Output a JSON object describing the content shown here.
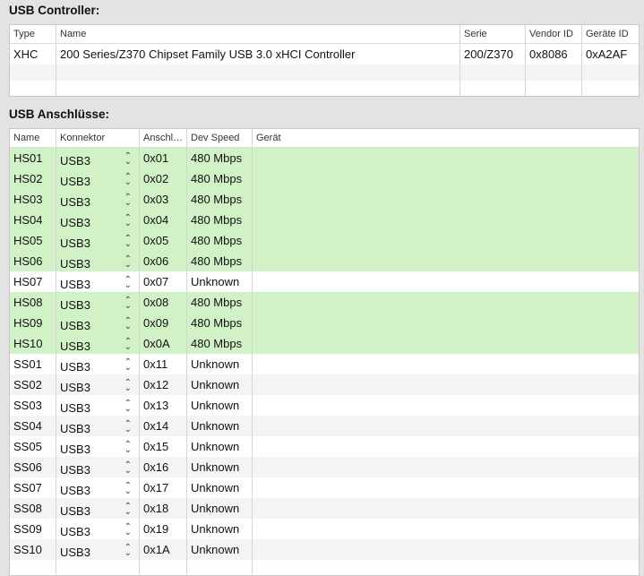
{
  "controller": {
    "title": "USB Controller:",
    "headers": [
      "Type",
      "Name",
      "Serie",
      "Vendor ID",
      "Geräte ID"
    ],
    "rows": [
      [
        "XHC",
        "200 Series/Z370 Chipset Family USB 3.0 xHCI Controller",
        "200/Z370",
        "0x8086",
        "0xA2AF"
      ]
    ]
  },
  "ports": {
    "title": "USB Anschlüsse:",
    "headers": [
      "Name",
      "Konnektor",
      "Anschl…",
      "Dev Speed",
      "Gerät"
    ],
    "colors": {
      "active": "#d1f2c6"
    },
    "rows": [
      {
        "name": "HS01",
        "connector": "USB3",
        "port": "0x01",
        "speed": "480 Mbps",
        "device": "",
        "active": true
      },
      {
        "name": "HS02",
        "connector": "USB3",
        "port": "0x02",
        "speed": "480 Mbps",
        "device": "",
        "active": true
      },
      {
        "name": "HS03",
        "connector": "USB3",
        "port": "0x03",
        "speed": "480 Mbps",
        "device": "",
        "active": true
      },
      {
        "name": "HS04",
        "connector": "USB3",
        "port": "0x04",
        "speed": "480 Mbps",
        "device": "",
        "active": true
      },
      {
        "name": "HS05",
        "connector": "USB3",
        "port": "0x05",
        "speed": "480 Mbps",
        "device": "",
        "active": true
      },
      {
        "name": "HS06",
        "connector": "USB3",
        "port": "0x06",
        "speed": "480 Mbps",
        "device": "",
        "active": true
      },
      {
        "name": "HS07",
        "connector": "USB3",
        "port": "0x07",
        "speed": "Unknown",
        "device": "",
        "active": false
      },
      {
        "name": "HS08",
        "connector": "USB3",
        "port": "0x08",
        "speed": "480 Mbps",
        "device": "",
        "active": true
      },
      {
        "name": "HS09",
        "connector": "USB3",
        "port": "0x09",
        "speed": "480 Mbps",
        "device": "",
        "active": true
      },
      {
        "name": "HS10",
        "connector": "USB3",
        "port": "0x0A",
        "speed": "480 Mbps",
        "device": "",
        "active": true
      },
      {
        "name": "SS01",
        "connector": "USB3",
        "port": "0x11",
        "speed": "Unknown",
        "device": "",
        "active": false
      },
      {
        "name": "SS02",
        "connector": "USB3",
        "port": "0x12",
        "speed": "Unknown",
        "device": "",
        "active": false
      },
      {
        "name": "SS03",
        "connector": "USB3",
        "port": "0x13",
        "speed": "Unknown",
        "device": "",
        "active": false
      },
      {
        "name": "SS04",
        "connector": "USB3",
        "port": "0x14",
        "speed": "Unknown",
        "device": "",
        "active": false
      },
      {
        "name": "SS05",
        "connector": "USB3",
        "port": "0x15",
        "speed": "Unknown",
        "device": "",
        "active": false
      },
      {
        "name": "SS06",
        "connector": "USB3",
        "port": "0x16",
        "speed": "Unknown",
        "device": "",
        "active": false
      },
      {
        "name": "SS07",
        "connector": "USB3",
        "port": "0x17",
        "speed": "Unknown",
        "device": "",
        "active": false
      },
      {
        "name": "SS08",
        "connector": "USB3",
        "port": "0x18",
        "speed": "Unknown",
        "device": "",
        "active": false
      },
      {
        "name": "SS09",
        "connector": "USB3",
        "port": "0x19",
        "speed": "Unknown",
        "device": "",
        "active": false
      },
      {
        "name": "SS10",
        "connector": "USB3",
        "port": "0x1A",
        "speed": "Unknown",
        "device": "",
        "active": false
      }
    ]
  }
}
